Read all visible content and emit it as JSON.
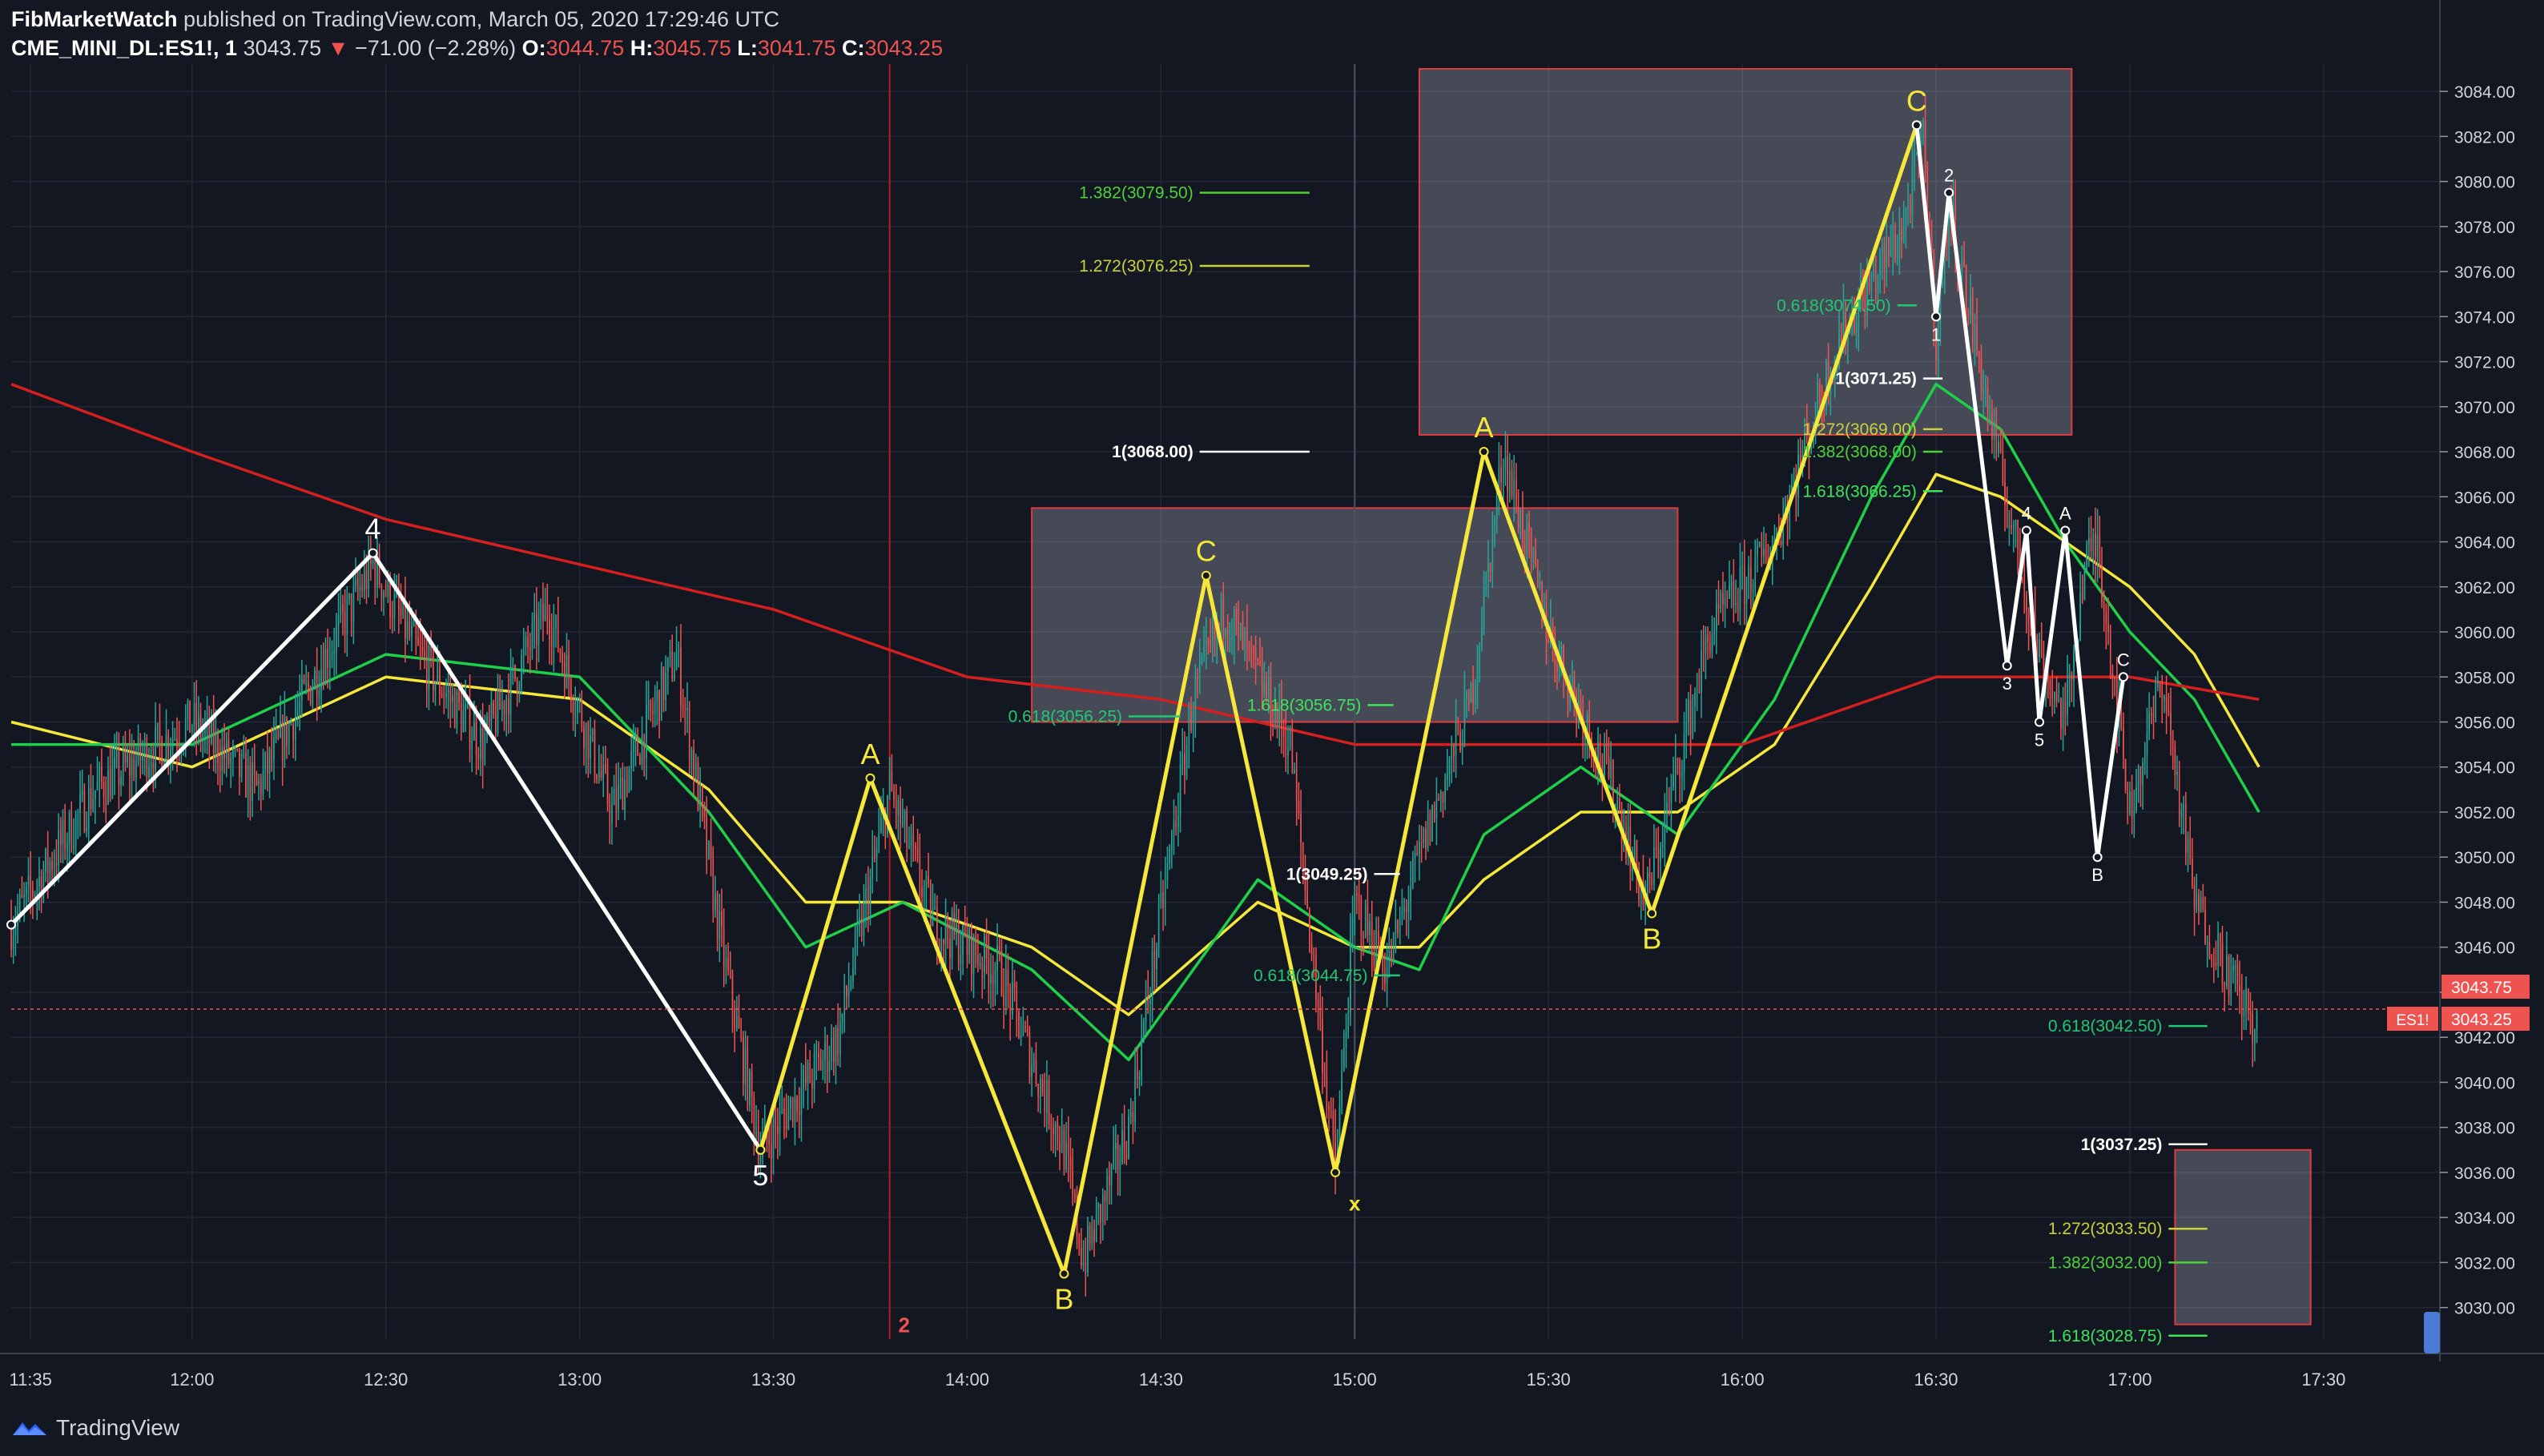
{
  "header": {
    "author": "FibMarketWatch",
    "published_text": "published on TradingView.com, March 05, 2020 17:29:46 UTC",
    "symbol": "CME_MINI_DL:ES1!, 1",
    "last": "3043.75",
    "change": "−71.00 (−2.28%)",
    "o_label": "O:",
    "o": "3044.75",
    "h_label": "H:",
    "h": "3045.75",
    "l_label": "L:",
    "l": "3041.75",
    "c_label": "C:",
    "c": "3043.25"
  },
  "footer": {
    "brand": "TradingView",
    "logo": "tradingview-logo-icon"
  },
  "colors": {
    "background": "#131722",
    "up": "#26a69a",
    "down": "#ef5350",
    "yellow": "#f5e83a",
    "green": "#1fcf4a",
    "red": "#d41f1f",
    "white": "#ffffff"
  },
  "chart_data": {
    "type": "candlestick",
    "symbol": "CME_MINI_DL:ES1!",
    "interval": "1",
    "y_ticks": [
      3030,
      3032,
      3034,
      3036,
      3038,
      3040,
      3042,
      3044,
      3046,
      3048,
      3050,
      3052,
      3054,
      3056,
      3058,
      3060,
      3062,
      3064,
      3066,
      3068,
      3070,
      3072,
      3074,
      3076,
      3078,
      3080,
      3082,
      3084
    ],
    "y_tick_labels": [
      "3030.00",
      "3032.00",
      "3034.00",
      "3036.00",
      "3038.00",
      "3040.00",
      "3042.00",
      "3044.00",
      "3046.00",
      "3048.00",
      "3050.00",
      "3052.00",
      "3054.00",
      "3056.00",
      "3058.00",
      "3060.00",
      "3062.00",
      "3064.00",
      "3066.00",
      "3068.00",
      "3070.00",
      "3072.00",
      "3074.00",
      "3076.00",
      "3078.00",
      "3080.00",
      "3082.00",
      "3084.00"
    ],
    "ylim": [
      3028.6,
      3085.0
    ],
    "xlim": [
      "11:32",
      "17:48"
    ],
    "x_ticks": [
      "11:35",
      "12:00",
      "12:30",
      "13:00",
      "13:30",
      "14:00",
      "14:30",
      "15:00",
      "15:30",
      "16:00",
      "16:30",
      "17:00",
      "17:30"
    ],
    "price_labels": [
      {
        "value": 3043.75,
        "text": "3043.75"
      },
      {
        "value": 3043.25,
        "text": "3043.25",
        "tag": "ES1!"
      }
    ],
    "price_pivots": [
      [
        "11:32",
        3047
      ],
      [
        "11:45",
        3053
      ],
      [
        "12:00",
        3056
      ],
      [
        "12:10",
        3053
      ],
      [
        "12:28",
        3063
      ],
      [
        "12:35",
        3059
      ],
      [
        "12:45",
        3055
      ],
      [
        "12:55",
        3061
      ],
      [
        "13:05",
        3052
      ],
      [
        "13:15",
        3059
      ],
      [
        "13:22",
        3046
      ],
      [
        "13:28",
        3037
      ],
      [
        "13:40",
        3042
      ],
      [
        "13:48",
        3053
      ],
      [
        "13:55",
        3047
      ],
      [
        "14:05",
        3045
      ],
      [
        "14:15",
        3037
      ],
      [
        "14:18",
        3032
      ],
      [
        "14:25",
        3038
      ],
      [
        "14:35",
        3057
      ],
      [
        "14:40",
        3061
      ],
      [
        "14:50",
        3055
      ],
      [
        "15:00",
        3048
      ],
      [
        "14:57",
        3036
      ],
      [
        "15:05",
        3045
      ],
      [
        "15:10",
        3050
      ],
      [
        "15:18",
        3057
      ],
      [
        "15:23",
        3068
      ],
      [
        "15:30",
        3060
      ],
      [
        "15:40",
        3053
      ],
      [
        "15:45",
        3048
      ],
      [
        "15:55",
        3060
      ],
      [
        "16:05",
        3064
      ],
      [
        "16:15",
        3073
      ],
      [
        "16:25",
        3078
      ],
      [
        "16:28",
        3082
      ],
      [
        "16:30",
        3073
      ],
      [
        "16:32",
        3079
      ],
      [
        "16:40",
        3067
      ],
      [
        "16:46",
        3059
      ],
      [
        "16:50",
        3056
      ],
      [
        "16:53",
        3063
      ],
      [
        "16:55",
        3064
      ],
      [
        "17:00",
        3052
      ],
      [
        "17:05",
        3058
      ],
      [
        "17:10",
        3048
      ],
      [
        "17:20",
        3042
      ]
    ],
    "moving_averages": [
      {
        "color": "#f5e83a",
        "points": [
          [
            "11:32",
            3056
          ],
          [
            "12:00",
            3054
          ],
          [
            "12:30",
            3058
          ],
          [
            "13:00",
            3057
          ],
          [
            "13:20",
            3053
          ],
          [
            "13:35",
            3048
          ],
          [
            "13:50",
            3048
          ],
          [
            "14:10",
            3046
          ],
          [
            "14:25",
            3043
          ],
          [
            "14:45",
            3048
          ],
          [
            "15:00",
            3046
          ],
          [
            "15:10",
            3046
          ],
          [
            "15:20",
            3049
          ],
          [
            "15:35",
            3052
          ],
          [
            "15:50",
            3052
          ],
          [
            "16:05",
            3055
          ],
          [
            "16:20",
            3062
          ],
          [
            "16:30",
            3067
          ],
          [
            "16:40",
            3066
          ],
          [
            "16:50",
            3064
          ],
          [
            "17:00",
            3062
          ],
          [
            "17:10",
            3059
          ],
          [
            "17:20",
            3054
          ]
        ]
      },
      {
        "color": "#1fcf4a",
        "points": [
          [
            "11:32",
            3055
          ],
          [
            "12:00",
            3055
          ],
          [
            "12:30",
            3059
          ],
          [
            "13:00",
            3058
          ],
          [
            "13:20",
            3052
          ],
          [
            "13:35",
            3046
          ],
          [
            "13:50",
            3048
          ],
          [
            "14:10",
            3045
          ],
          [
            "14:25",
            3041
          ],
          [
            "14:45",
            3049
          ],
          [
            "15:00",
            3046
          ],
          [
            "15:10",
            3045
          ],
          [
            "15:20",
            3051
          ],
          [
            "15:35",
            3054
          ],
          [
            "15:50",
            3051
          ],
          [
            "16:05",
            3057
          ],
          [
            "16:20",
            3066
          ],
          [
            "16:30",
            3071
          ],
          [
            "16:40",
            3069
          ],
          [
            "16:50",
            3064
          ],
          [
            "17:00",
            3060
          ],
          [
            "17:10",
            3057
          ],
          [
            "17:20",
            3052
          ]
        ]
      },
      {
        "color": "#d41f1f",
        "points": [
          [
            "11:32",
            3071
          ],
          [
            "12:00",
            3068
          ],
          [
            "12:30",
            3065
          ],
          [
            "13:00",
            3063
          ],
          [
            "13:30",
            3061
          ],
          [
            "14:00",
            3058
          ],
          [
            "14:30",
            3057
          ],
          [
            "15:00",
            3055
          ],
          [
            "15:30",
            3055
          ],
          [
            "16:00",
            3055
          ],
          [
            "16:30",
            3058
          ],
          [
            "17:00",
            3058
          ],
          [
            "17:20",
            3057
          ]
        ]
      }
    ],
    "waves": [
      {
        "color": "#ffffff",
        "points": [
          [
            "11:32",
            3047
          ],
          [
            "12:28",
            3063.5
          ],
          [
            "13:28",
            3037
          ]
        ],
        "labels": [
          {
            "text": "4",
            "at": [
              "12:28",
              3063.5
            ]
          },
          {
            "text": "5",
            "at": [
              "13:28",
              3037
            ]
          }
        ]
      },
      {
        "color": "#f5e83a",
        "points": [
          [
            "13:28",
            3037
          ],
          [
            "13:45",
            3053.5
          ],
          [
            "14:15",
            3031.5
          ],
          [
            "14:37",
            3062.5
          ],
          [
            "14:57",
            3036
          ],
          [
            "15:20",
            3068
          ],
          [
            "15:46",
            3047.5
          ],
          [
            "16:27",
            3082.5
          ]
        ],
        "labels": [
          {
            "text": "A",
            "at": [
              "13:45",
              3053.5
            ]
          },
          {
            "text": "B",
            "at": [
              "14:15",
              3031.5
            ]
          },
          {
            "text": "C",
            "at": [
              "14:37",
              3062.5
            ]
          },
          {
            "text": "A",
            "at": [
              "15:20",
              3068
            ]
          },
          {
            "text": "B",
            "at": [
              "15:46",
              3047.5
            ]
          },
          {
            "text": "C",
            "at": [
              "16:27",
              3082.5
            ]
          }
        ]
      },
      {
        "color": "#ffffff",
        "points": [
          [
            "16:27",
            3082.5
          ],
          [
            "16:30",
            3074
          ],
          [
            "16:32",
            3079.5
          ],
          [
            "16:41",
            3058.5
          ],
          [
            "16:44",
            3064.5
          ],
          [
            "16:46",
            3056
          ],
          [
            "16:50",
            3064.5
          ],
          [
            "16:55",
            3050
          ],
          [
            "16:59",
            3058
          ]
        ],
        "labels": [
          {
            "text": "1",
            "at": [
              "16:30",
              3074
            ]
          },
          {
            "text": "2",
            "at": [
              "16:32",
              3079.5
            ]
          },
          {
            "text": "3",
            "at": [
              "16:41",
              3058.5
            ]
          },
          {
            "text": "4",
            "at": [
              "16:44",
              3064.5
            ]
          },
          {
            "text": "5",
            "at": [
              "16:46",
              3056
            ]
          },
          {
            "text": "A",
            "at": [
              "16:50",
              3064.5
            ]
          },
          {
            "text": "B",
            "at": [
              "16:55",
              3050
            ]
          },
          {
            "text": "C",
            "at": [
              "16:59",
              3058
            ]
          }
        ]
      }
    ],
    "zones": [
      {
        "x1": "15:10",
        "x2": "16:51",
        "y1": 3068.75,
        "y2": 3085
      },
      {
        "x1": "14:10",
        "x2": "15:50",
        "y1": 3056,
        "y2": 3065.5
      },
      {
        "x1": "17:07",
        "x2": "17:28",
        "y1": 3029.25,
        "y2": 3037
      }
    ],
    "fib_levels": [
      {
        "text": "1.382(3079.50)",
        "value": 3079.5,
        "color": "#4cd137",
        "x1": "14:36",
        "x2": "14:53"
      },
      {
        "text": "1.272(3076.25)",
        "value": 3076.25,
        "color": "#c9d23a",
        "x1": "14:36",
        "x2": "14:53"
      },
      {
        "text": "1(3068.00)",
        "value": 3068,
        "color": "#ffffff",
        "x1": "14:36",
        "x2": "14:53"
      },
      {
        "text": "0.618(3056.25)",
        "value": 3056.25,
        "color": "#22c774",
        "x1": "14:25",
        "x2": "14:33"
      },
      {
        "text": "1.618(3056.75)",
        "value": 3056.75,
        "color": "#3ce35b",
        "x1": "15:02",
        "x2": "15:06"
      },
      {
        "text": "1(3049.25)",
        "value": 3049.25,
        "color": "#ffffff",
        "x1": "15:03",
        "x2": "15:07"
      },
      {
        "text": "0.618(3044.75)",
        "value": 3044.75,
        "color": "#22c774",
        "x1": "15:03",
        "x2": "15:07"
      },
      {
        "text": "0.618(3074.50)",
        "value": 3074.5,
        "color": "#22c774",
        "x1": "16:24",
        "x2": "16:27"
      },
      {
        "text": "1(3071.25)",
        "value": 3071.25,
        "color": "#ffffff",
        "x1": "16:28",
        "x2": "16:31"
      },
      {
        "text": "1.272(3069.00)",
        "value": 3069,
        "color": "#c9d23a",
        "x1": "16:28",
        "x2": "16:31"
      },
      {
        "text": "1.382(3068.00)",
        "value": 3068,
        "color": "#4cd137",
        "x1": "16:28",
        "x2": "16:31"
      },
      {
        "text": "1.618(3066.25)",
        "value": 3066.25,
        "color": "#3ce35b",
        "x1": "16:28",
        "x2": "16:31"
      },
      {
        "text": "0.618(3042.50)",
        "value": 3042.5,
        "color": "#22c774",
        "x1": "17:06",
        "x2": "17:12"
      },
      {
        "text": "1(3037.25)",
        "value": 3037.25,
        "color": "#ffffff",
        "x1": "17:06",
        "x2": "17:12"
      },
      {
        "text": "1.272(3033.50)",
        "value": 3033.5,
        "color": "#c9d23a",
        "x1": "17:06",
        "x2": "17:12"
      },
      {
        "text": "1.382(3032.00)",
        "value": 3032,
        "color": "#4cd137",
        "x1": "17:06",
        "x2": "17:12"
      },
      {
        "text": "1.618(3028.75)",
        "value": 3028.75,
        "color": "#3ce35b",
        "x1": "17:06",
        "x2": "17:12"
      }
    ],
    "markers": [
      {
        "text": "x",
        "time": "15:00",
        "value": 3034.8,
        "color": "#f5e83a"
      },
      {
        "text": "2",
        "time": "13:48",
        "value": 3029.4,
        "color": "#ef5350"
      }
    ],
    "vertical_lines": [
      {
        "time": "13:48",
        "color": "#b71c1c"
      },
      {
        "time": "15:00",
        "color": "#4a5060"
      }
    ],
    "current_price_line": 3043.25,
    "grid": true
  }
}
